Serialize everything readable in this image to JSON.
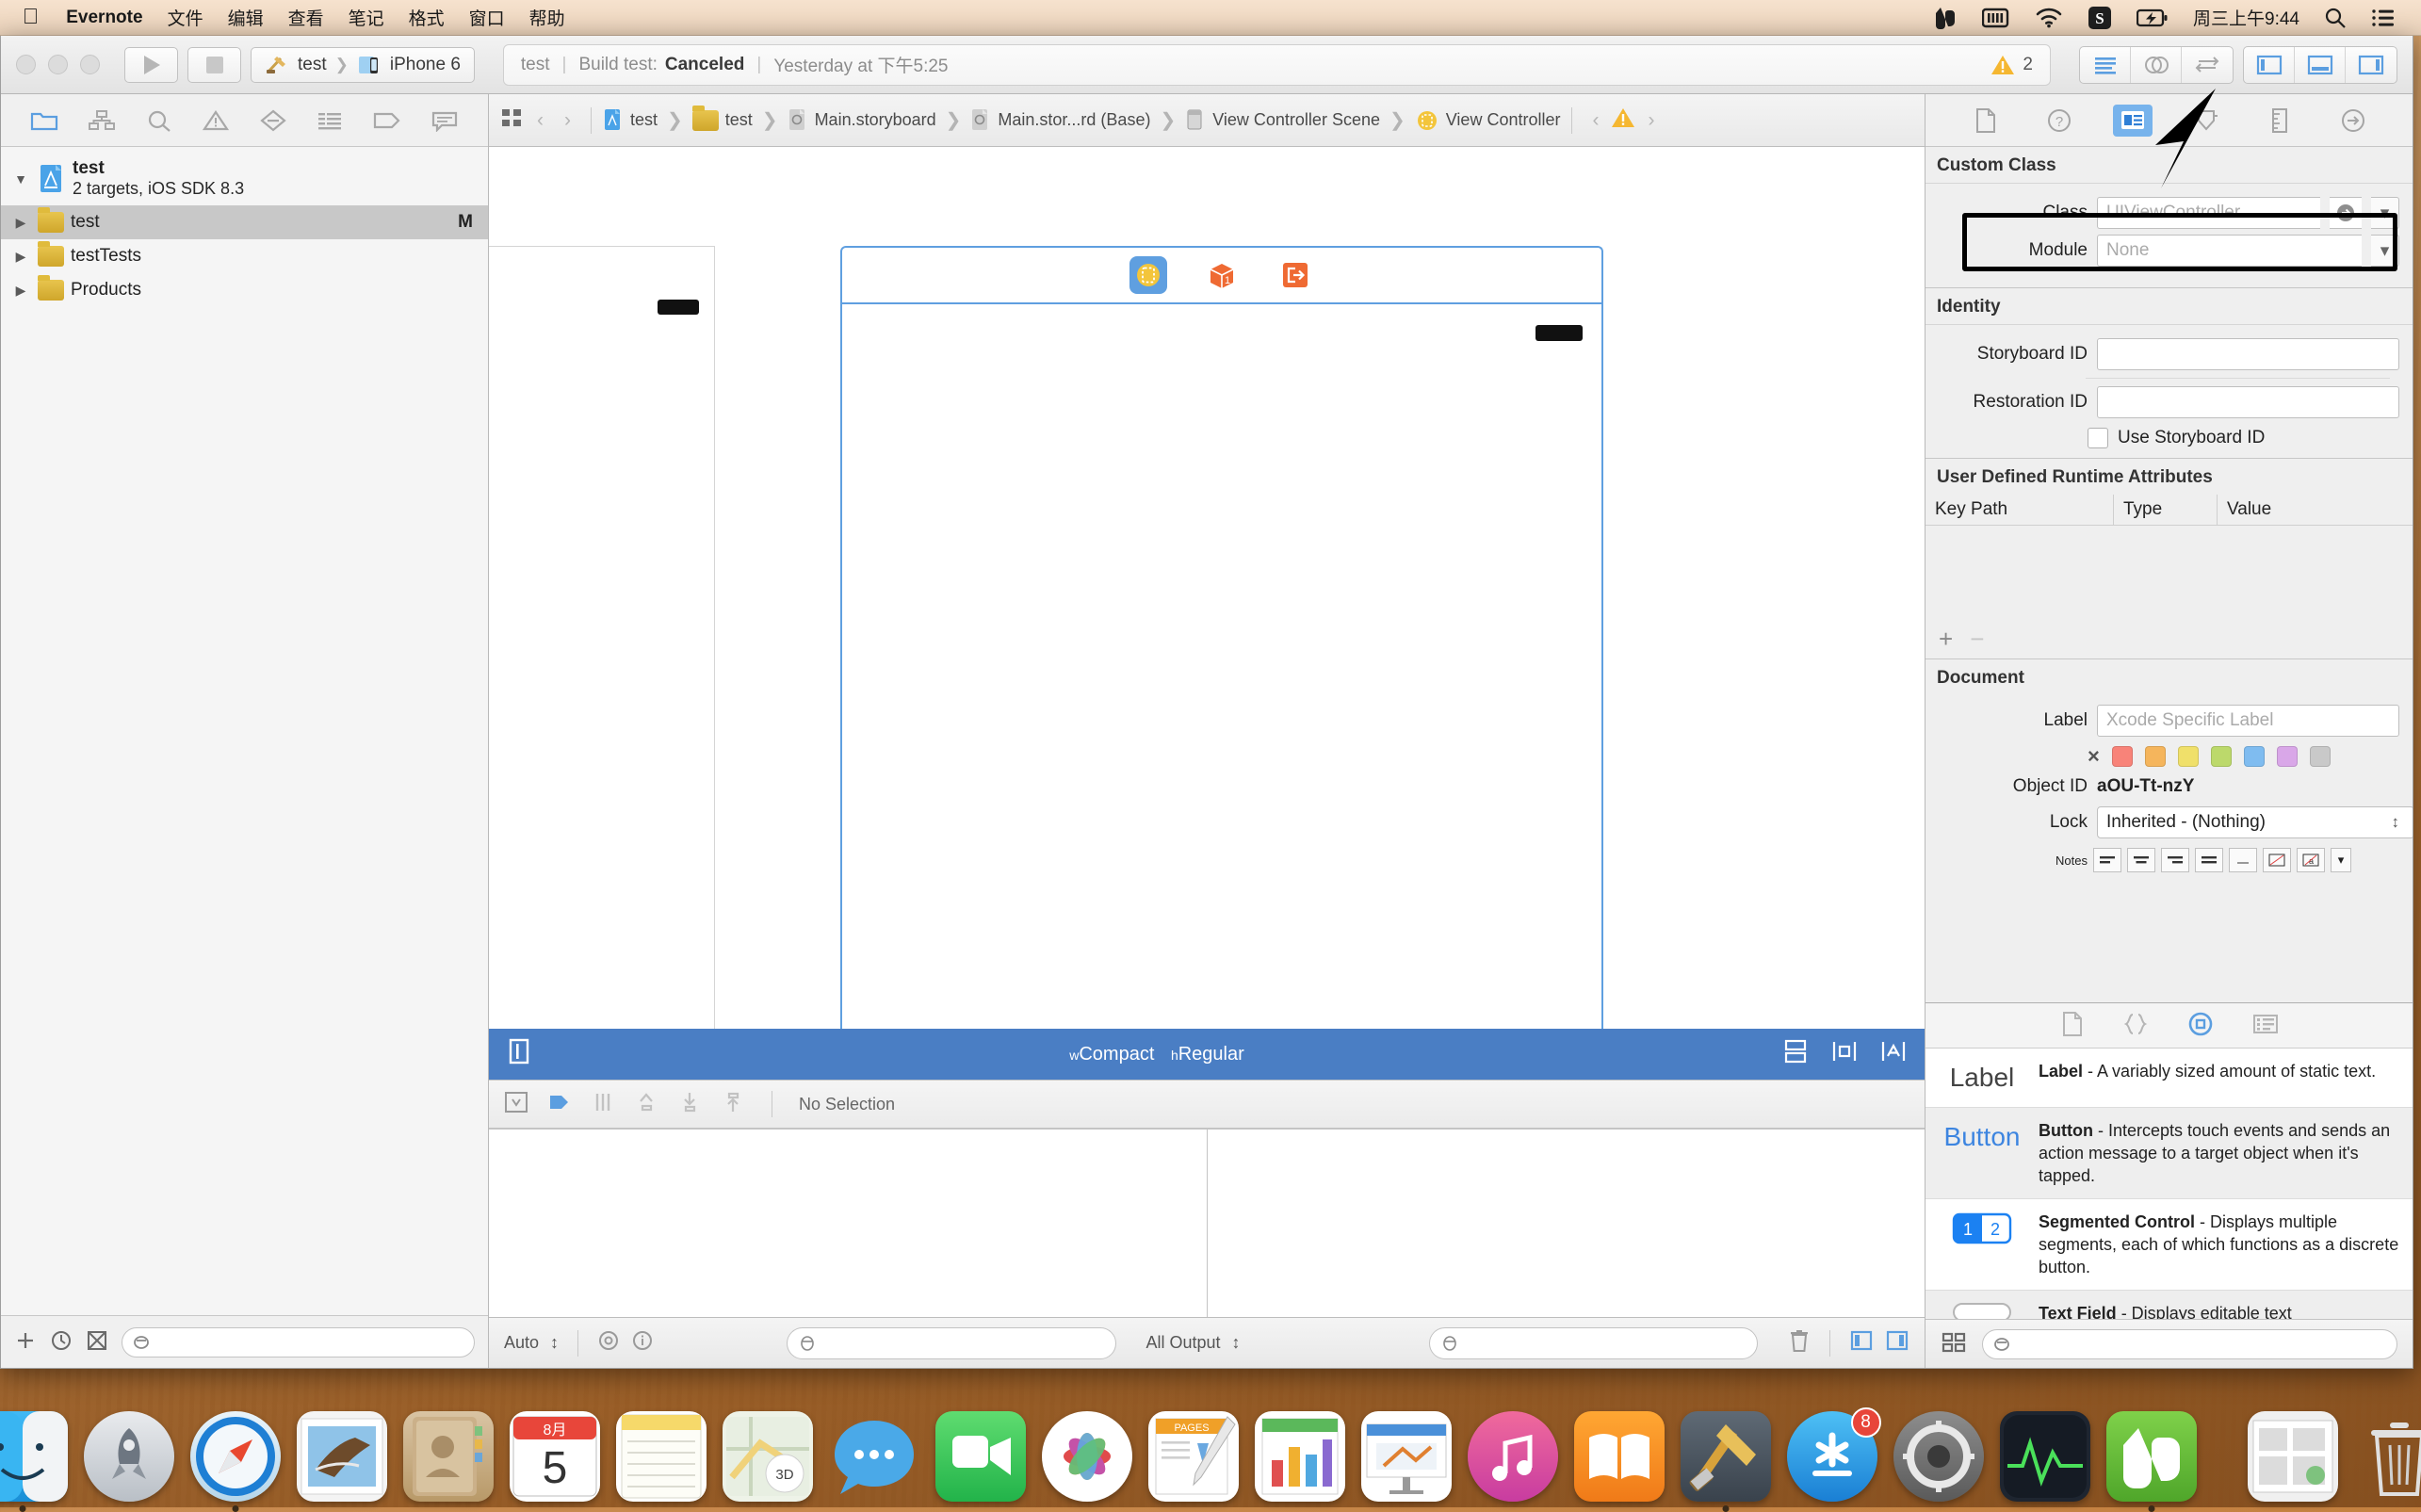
{
  "menubar": {
    "apple": "apple-logo",
    "app": "Evernote",
    "items": [
      "文件",
      "编辑",
      "查看",
      "笔记",
      "格式",
      "窗口",
      "帮助"
    ],
    "status_icons": [
      "evernote-icon",
      "battery-meter-icon",
      "wifi-icon",
      "sogou-input-icon",
      "battery-charging-icon"
    ],
    "clock": "周三上午9:44",
    "search": "search-icon",
    "notifications": "notification-center-icon"
  },
  "toolbar": {
    "run_label": "▶",
    "stop_label": "■",
    "scheme_project": "test",
    "scheme_device": "iPhone 6",
    "status": {
      "project": "test",
      "action": "Build test:",
      "result": "Canceled",
      "time": "Yesterday at 下午5:25",
      "warning_count": "2"
    },
    "editor_modes": [
      "standard-editor",
      "assistant-editor",
      "version-editor"
    ],
    "view_toggles": [
      "toggle-navigator",
      "toggle-debug-area",
      "toggle-utilities"
    ]
  },
  "navigator": {
    "tabs": [
      "project-navigator",
      "symbol-navigator",
      "find-navigator",
      "issue-navigator",
      "test-navigator",
      "debug-navigator",
      "breakpoint-navigator",
      "report-navigator"
    ],
    "project": {
      "name": "test",
      "subtitle": "2 targets, iOS SDK 8.3"
    },
    "items": [
      {
        "label": "test",
        "flag": "M",
        "selected": true
      },
      {
        "label": "testTests",
        "flag": "",
        "selected": false
      },
      {
        "label": "Products",
        "flag": "",
        "selected": false
      }
    ],
    "bottom_icons": [
      "add-icon",
      "recent-icon",
      "source-control-icon"
    ],
    "filter_placeholder": ""
  },
  "jumpbar": {
    "related_icon": "related-files-icon",
    "back": "‹",
    "forward": "›",
    "crumbs": [
      "test",
      "test",
      "Main.storyboard",
      "Main.stor...rd (Base)",
      "View Controller Scene",
      "View Controller"
    ],
    "issue_nav_back": "‹",
    "issue_icon": "warning-icon",
    "issue_nav_forward": "›"
  },
  "canvas": {
    "dock_icons": [
      "view-controller-icon",
      "first-responder-icon",
      "exit-icon"
    ],
    "entry_point": "storyboard-entry-point-arrow",
    "sizebar": {
      "left_icon": "device-preview-icon",
      "width_prefix": "w",
      "width_class": "Compact",
      "height_prefix": "h",
      "height_class": "Regular",
      "right_icons": [
        "auto-layout-align-icon",
        "auto-layout-pin-icon",
        "auto-layout-resolve-icon"
      ]
    },
    "outline_bar": {
      "icons": [
        "document-outline-icon",
        "segue-icon",
        "constraints-icon",
        "align-icon",
        "pin-icon",
        "resolve-icon"
      ],
      "selection": "No Selection"
    }
  },
  "debugbar": {
    "auto_label": "Auto",
    "view_icons": [
      "debug-view-hierarchy-icon",
      "info-icon"
    ],
    "console_filter_placeholder": "",
    "output_label": "All Output",
    "trash_icon": "trash-icon",
    "split_icons": [
      "variables-view-icon",
      "console-view-icon"
    ]
  },
  "inspector": {
    "tabs": [
      "file-inspector",
      "quick-help-inspector",
      "identity-inspector",
      "attributes-inspector",
      "size-inspector",
      "connections-inspector"
    ],
    "selected_tab_index": 2,
    "custom_class": {
      "title": "Custom Class",
      "class_label": "Class",
      "class_value": "UIViewController",
      "module_label": "Module",
      "module_value": "None"
    },
    "identity": {
      "title": "Identity",
      "storyboard_id_label": "Storyboard ID",
      "storyboard_id_value": "",
      "restoration_id_label": "Restoration ID",
      "restoration_id_value": "",
      "use_storyboard_id_label": "Use Storyboard ID",
      "use_storyboard_id_checked": false
    },
    "runtime_attributes": {
      "title": "User Defined Runtime Attributes",
      "columns": [
        "Key Path",
        "Type",
        "Value"
      ],
      "rows": [],
      "add_label": "+",
      "remove_label": "−"
    },
    "document": {
      "title": "Document",
      "label_label": "Label",
      "label_placeholder": "Xcode Specific Label",
      "clear_color": "×",
      "colors": [
        "#f88379",
        "#f5b55c",
        "#f0e06a",
        "#bcd96b",
        "#7fbcf0",
        "#d9a7e8",
        "#c9c9c9"
      ],
      "object_id_label": "Object ID",
      "object_id_value": "aOU-Tt-nzY",
      "lock_label": "Lock",
      "lock_value": "Inherited - (Nothing)",
      "notes_label": "Notes"
    }
  },
  "library": {
    "tabs": [
      "file-template-library",
      "code-snippet-library",
      "object-library",
      "media-library"
    ],
    "selected_tab_index": 2,
    "items": [
      {
        "icon_text": "Label",
        "title": "Label",
        "desc": " - A variably sized amount of static text."
      },
      {
        "icon_text": "Button",
        "title": "Button",
        "desc": " - Intercepts touch events and sends an action message to a target object when it's tapped."
      },
      {
        "icon_text": "1 2",
        "title": "Segmented Control",
        "desc": " - Displays multiple segments, each of which functions as a discrete button."
      },
      {
        "icon_text": "",
        "title": "Text Field",
        "desc": " - Displays editable text"
      }
    ],
    "bottom_icons": [
      "grid-view-icon"
    ],
    "filter_placeholder": ""
  },
  "annotation": {
    "box": "highlight-rectangle",
    "arrow": "pointer-arrow"
  },
  "dock": {
    "apps": [
      {
        "name": "finder-icon",
        "running": true
      },
      {
        "name": "launchpad-icon",
        "running": false
      },
      {
        "name": "safari-icon",
        "running": true
      },
      {
        "name": "mail-icon",
        "running": false
      },
      {
        "name": "contacts-icon",
        "running": false
      },
      {
        "name": "calendar-icon",
        "running": false
      },
      {
        "name": "notes-icon",
        "running": false
      },
      {
        "name": "maps-icon",
        "running": false
      },
      {
        "name": "messages-icon",
        "running": false
      },
      {
        "name": "facetime-icon",
        "running": false
      },
      {
        "name": "photos-icon",
        "running": false
      },
      {
        "name": "pages-icon",
        "running": false
      },
      {
        "name": "numbers-icon",
        "running": false
      },
      {
        "name": "keynote-icon",
        "running": false
      },
      {
        "name": "itunes-icon",
        "running": false
      },
      {
        "name": "ibooks-icon",
        "running": false
      },
      {
        "name": "xcode-icon",
        "running": true
      },
      {
        "name": "app-store-icon",
        "badge": "8",
        "running": false
      },
      {
        "name": "system-preferences-icon",
        "running": false
      },
      {
        "name": "activity-monitor-icon",
        "running": false
      },
      {
        "name": "evernote-icon",
        "running": true
      },
      {
        "name": "stack-folder-icon",
        "running": false
      },
      {
        "name": "trash-icon",
        "running": false
      }
    ],
    "calendar_month": "8月",
    "calendar_day": "5",
    "appstore_badge": "8"
  }
}
